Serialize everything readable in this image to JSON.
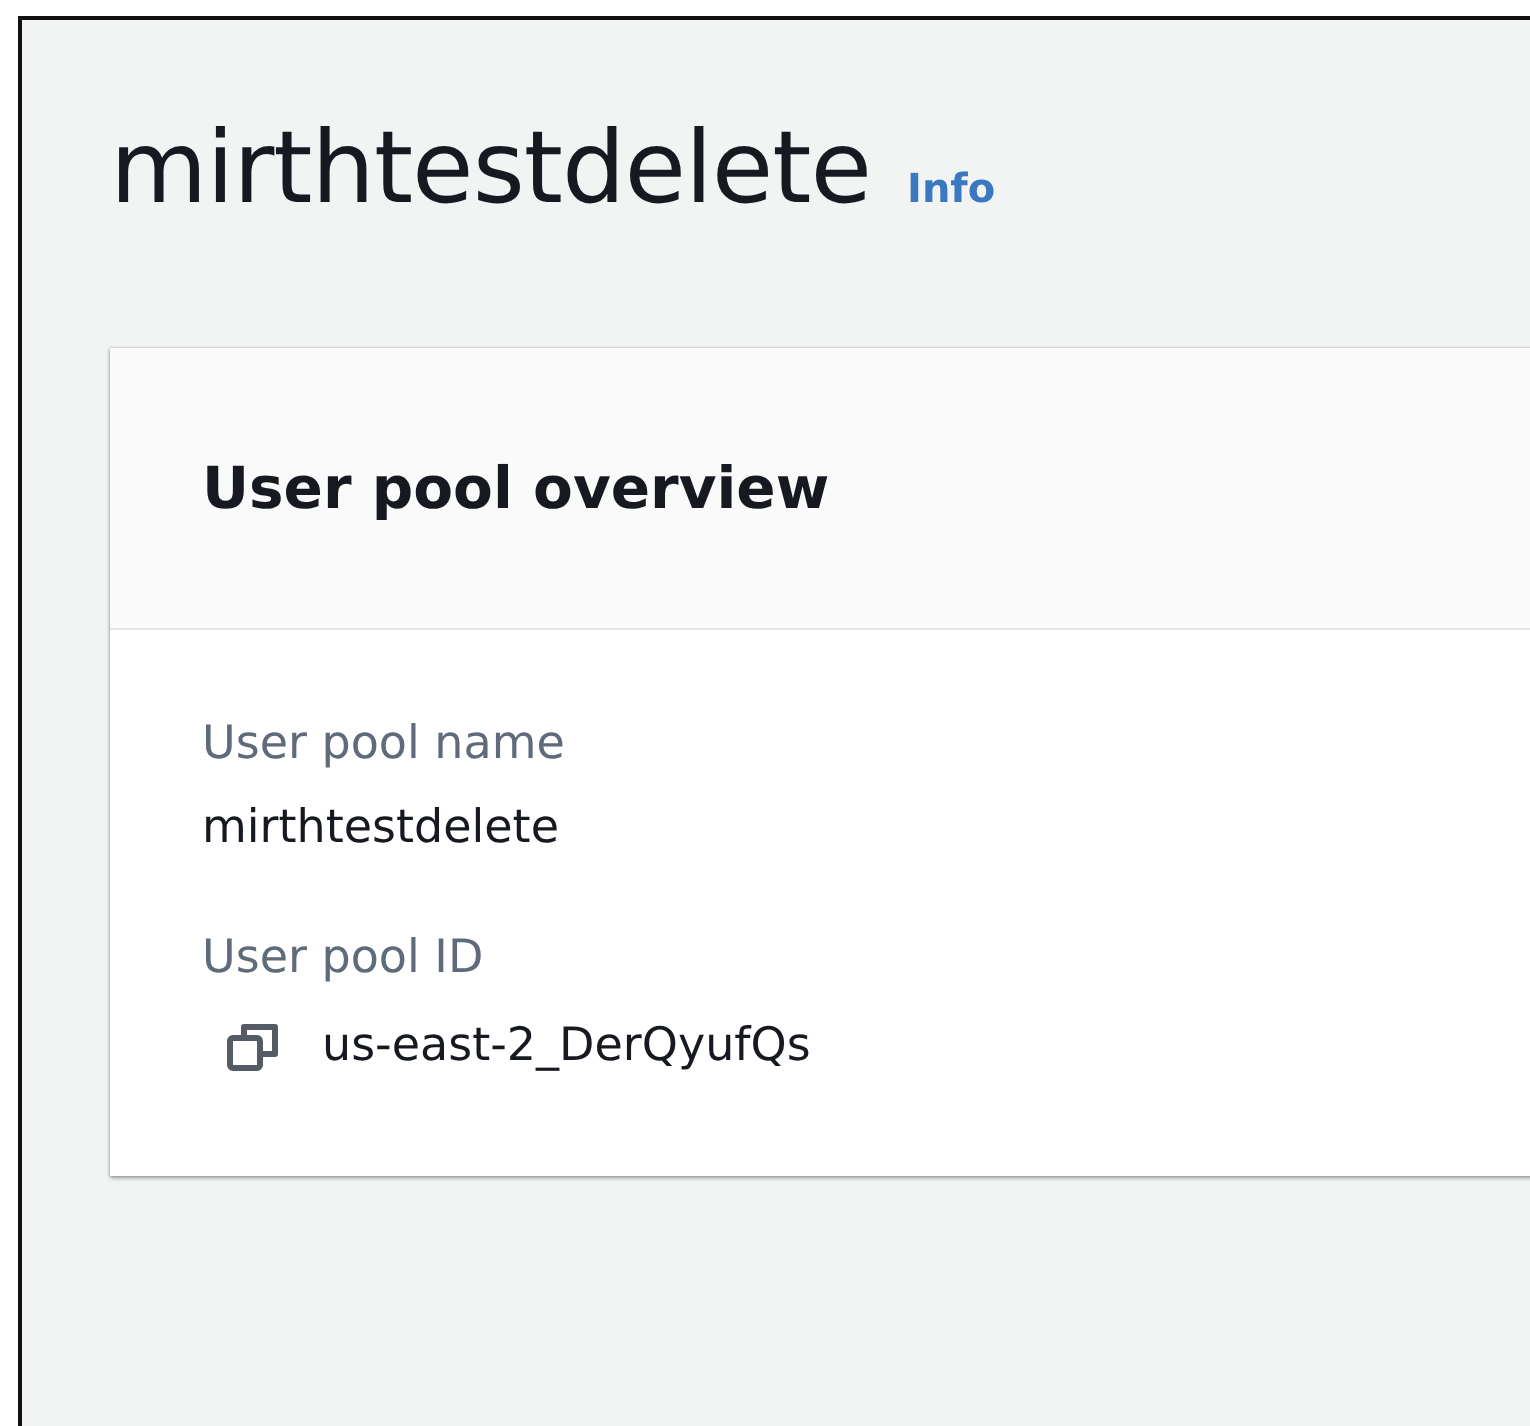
{
  "page": {
    "title": "mirthtestdelete",
    "info_link": "Info"
  },
  "panel": {
    "title": "User pool overview",
    "fields": [
      {
        "label": "User pool name",
        "value": "mirthtestdelete",
        "copyable": false
      },
      {
        "label": "User pool ID",
        "value": "us-east-2_DerQyufQs",
        "copyable": true
      }
    ]
  }
}
